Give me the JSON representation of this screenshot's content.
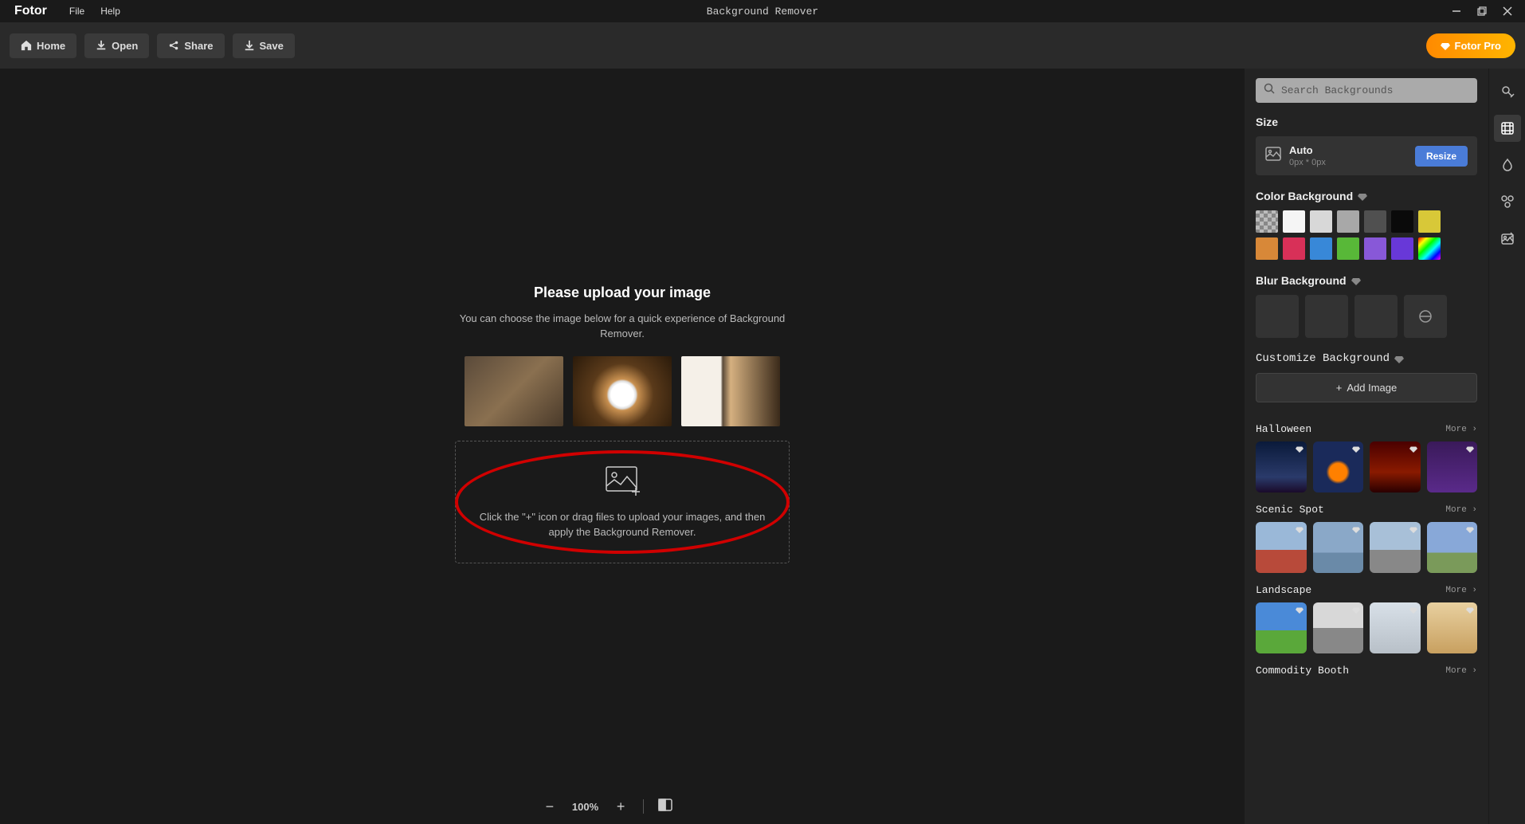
{
  "brand": "Fotor",
  "menu": {
    "file": "File",
    "help": "Help"
  },
  "window_title": "Background Remover",
  "toolbar": {
    "home": "Home",
    "open": "Open",
    "share": "Share",
    "save": "Save",
    "pro": "Fotor Pro"
  },
  "canvas": {
    "title": "Please upload your image",
    "subtitle": "You can choose the image below for a quick experience of Background Remover.",
    "drop_text": "Click the \"+\" icon or drag files to upload your images, and then apply the Background Remover."
  },
  "zoom": {
    "value": "100%"
  },
  "sidebar": {
    "search_placeholder": "Search Backgrounds",
    "size_label": "Size",
    "size_mode": "Auto",
    "size_dims": "0px * 0px",
    "resize": "Resize",
    "color_bg_label": "Color Background",
    "blur_bg_label": "Blur Background",
    "customize_label": "Customize Background",
    "add_image": "Add Image",
    "more": "More",
    "colors_row1": [
      "transparent",
      "#f5f5f5",
      "#d8d8d8",
      "#a8a8a8",
      "#505050",
      "#0a0a0a",
      "#d8c838"
    ],
    "colors_row2": [
      "#d88838",
      "#d83058",
      "#3888d8",
      "#58b838",
      "#8858d8",
      "#6838d8",
      "gradient"
    ],
    "categories": [
      {
        "name": "Halloween",
        "thumbs": [
          "hw1",
          "hw2",
          "hw3",
          "hw4"
        ]
      },
      {
        "name": "Scenic Spot",
        "thumbs": [
          "sc1",
          "sc2",
          "sc3",
          "sc4"
        ]
      },
      {
        "name": "Landscape",
        "thumbs": [
          "ls1",
          "ls2",
          "ls3",
          "ls4"
        ]
      },
      {
        "name": "Commodity Booth",
        "thumbs": []
      }
    ]
  }
}
